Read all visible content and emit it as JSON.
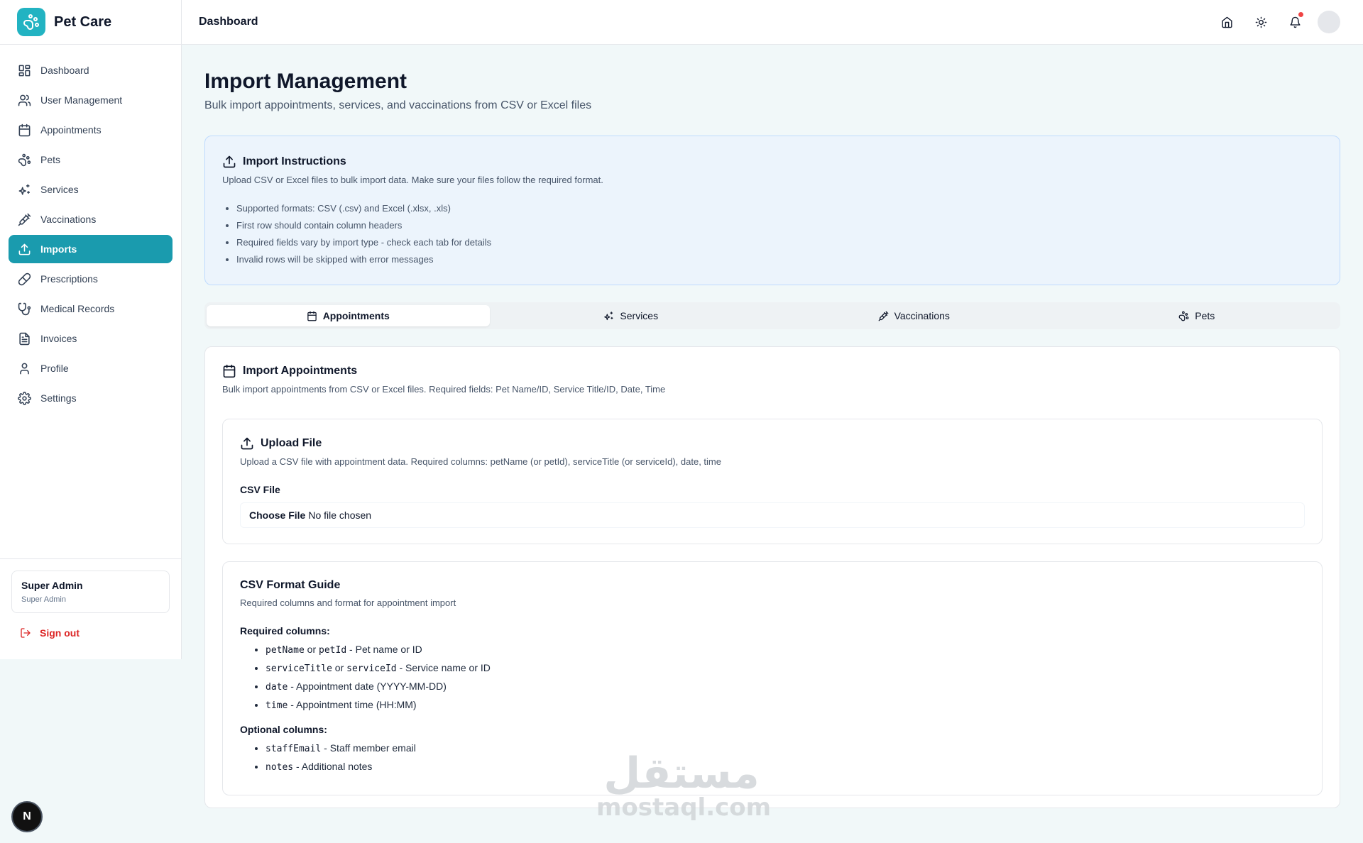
{
  "brand": {
    "name": "Pet Care",
    "icon": "paw-icon",
    "color": "#22b3c2"
  },
  "sidebar": {
    "active_color": "#1a9bae",
    "items": [
      {
        "label": "Dashboard",
        "icon": "dashboard-icon"
      },
      {
        "label": "User Management",
        "icon": "users-icon"
      },
      {
        "label": "Appointments",
        "icon": "calendar-icon"
      },
      {
        "label": "Pets",
        "icon": "paw-icon"
      },
      {
        "label": "Services",
        "icon": "sparkles-icon"
      },
      {
        "label": "Vaccinations",
        "icon": "syringe-icon"
      },
      {
        "label": "Imports",
        "icon": "upload-icon",
        "active": true
      },
      {
        "label": "Prescriptions",
        "icon": "pill-icon"
      },
      {
        "label": "Medical Records",
        "icon": "stethoscope-icon"
      },
      {
        "label": "Invoices",
        "icon": "file-text-icon"
      },
      {
        "label": "Profile",
        "icon": "user-icon"
      },
      {
        "label": "Settings",
        "icon": "gear-icon"
      }
    ],
    "user": {
      "name": "Super Admin",
      "role": "Super Admin"
    },
    "sign_out": "Sign out"
  },
  "header": {
    "title": "Dashboard",
    "actions": [
      "home-icon",
      "sun-icon",
      "bell-icon",
      "avatar"
    ],
    "notification_color": "#ef4444"
  },
  "page": {
    "title": "Import Management",
    "subtitle": "Bulk import appointments, services, and vaccinations from CSV or Excel files"
  },
  "instructions": {
    "title": "Import Instructions",
    "description": "Upload CSV or Excel files to bulk import data. Make sure your files follow the required format.",
    "items": [
      "Supported formats: CSV (.csv) and Excel (.xlsx, .xls)",
      "First row should contain column headers",
      "Required fields vary by import type - check each tab for details",
      "Invalid rows will be skipped with error messages"
    ]
  },
  "tabs": [
    {
      "label": "Appointments",
      "icon": "calendar-icon",
      "active": true
    },
    {
      "label": "Services",
      "icon": "sparkles-icon"
    },
    {
      "label": "Vaccinations",
      "icon": "syringe-icon"
    },
    {
      "label": "Pets",
      "icon": "paw-icon"
    }
  ],
  "import_card": {
    "title": "Import Appointments",
    "description": "Bulk import appointments from CSV or Excel files. Required fields: Pet Name/ID, Service Title/ID, Date, Time",
    "upload": {
      "title": "Upload File",
      "description": "Upload a CSV file with appointment data. Required columns: petName (or petId), serviceTitle (or serviceId), date, time",
      "field_label": "CSV File",
      "button_label": "Choose File",
      "status": "No file chosen"
    },
    "guide": {
      "title": "CSV Format Guide",
      "description": "Required columns and format for appointment import",
      "required_label": "Required columns:",
      "required": [
        {
          "code1": "petName",
          "mid": " or ",
          "code2": "petId",
          "desc": " - Pet name or ID"
        },
        {
          "code1": "serviceTitle",
          "mid": " or ",
          "code2": "serviceId",
          "desc": " - Service name or ID"
        },
        {
          "code1": "date",
          "desc": " - Appointment date (YYYY-MM-DD)"
        },
        {
          "code1": "time",
          "desc": " - Appointment time (HH:MM)"
        }
      ],
      "optional_label": "Optional columns:",
      "optional": [
        {
          "code1": "staffEmail",
          "desc": " - Staff member email"
        },
        {
          "code1": "notes",
          "desc": " - Additional notes"
        }
      ]
    }
  },
  "dev_badge": "N",
  "watermark": {
    "arabic": "مستقل",
    "latin": "mostaql.com"
  }
}
